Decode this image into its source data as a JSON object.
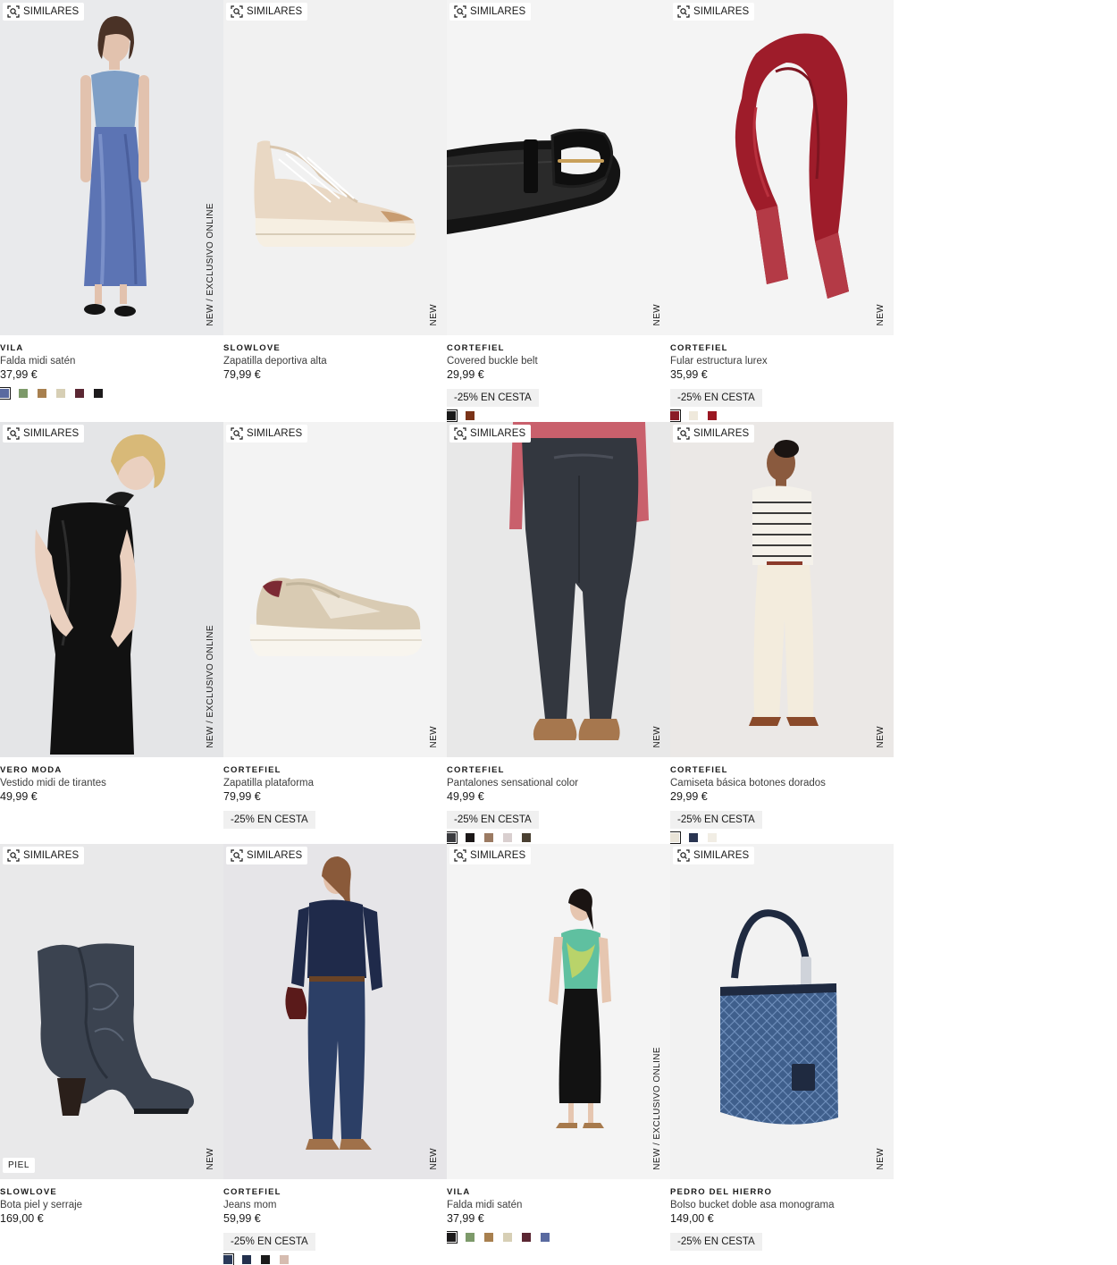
{
  "labels": {
    "similares": "SIMILARES"
  },
  "products": [
    {
      "brand": "VILA",
      "name": "Falda midi satén",
      "price": "37,99 €",
      "tag": "NEW  /  EXCLUSIVO ONLINE",
      "promo": null,
      "bg": "#e9eaec",
      "colors": [
        "#5a6aa0",
        "#7d9a6a",
        "#a8804f",
        "#d7cfb5",
        "#5b2733",
        "#1d1b1c"
      ]
    },
    {
      "brand": "SLOWLOVE",
      "name": "Zapatilla deportiva alta",
      "price": "79,99 €",
      "tag": "NEW",
      "promo": null,
      "bg": "#f1f1f1",
      "colors": []
    },
    {
      "brand": "CORTEFIEL",
      "name": "Covered buckle belt",
      "price": "29,99 €",
      "tag": "NEW",
      "promo": "-25% EN CESTA",
      "bg": "#f4f4f4",
      "colors": [
        "#1a1a1a",
        "#7a3318"
      ]
    },
    {
      "brand": "CORTEFIEL",
      "name": "Fular estructura lurex",
      "price": "35,99 €",
      "tag": "NEW",
      "promo": "-25% EN CESTA",
      "bg": "#f4f4f4",
      "colors": [
        "#8a1c26",
        "#efe9dc",
        "#9a1722"
      ]
    },
    {
      "brand": "VERO MODA",
      "name": "Vestido midi de tirantes",
      "price": "49,99 €",
      "tag": "NEW  /  EXCLUSIVO ONLINE",
      "promo": null,
      "bg": "#e4e5e7",
      "colors": []
    },
    {
      "brand": "CORTEFIEL",
      "name": "Zapatilla plataforma",
      "price": "79,99 €",
      "tag": "NEW",
      "promo": "-25% EN CESTA",
      "bg": "#f3f3f3",
      "colors": []
    },
    {
      "brand": "CORTEFIEL",
      "name": "Pantalones sensational color",
      "price": "49,99 €",
      "tag": "NEW",
      "promo": "-25% EN CESTA",
      "bg": "#e8e8e8",
      "colors": [
        "#3a3b3f",
        "#1b1717",
        "#9b7a62",
        "#d9cfcf",
        "#4a4032"
      ]
    },
    {
      "brand": "CORTEFIEL",
      "name": "Camiseta básica botones dorados",
      "price": "29,99 €",
      "tag": "NEW",
      "promo": "-25% EN CESTA",
      "bg": "#ebe8e6",
      "colors": [
        "#e9e4d8",
        "#2a3552",
        "#f1ede4"
      ]
    },
    {
      "brand": "SLOWLOVE",
      "name": "Bota piel y serraje",
      "price": "169,00 €",
      "tag": "NEW",
      "promo": null,
      "badge": "PIEL",
      "bg": "#e9e9ea",
      "colors": []
    },
    {
      "brand": "CORTEFIEL",
      "name": "Jeans mom",
      "price": "59,99 €",
      "tag": "NEW",
      "promo": "-25% EN CESTA",
      "bg": "#e6e5e8",
      "colors": [
        "#2b3a5a",
        "#23304d",
        "#1a1a1a",
        "#d6bcb0"
      ]
    },
    {
      "brand": "VILA",
      "name": "Falda midi satén",
      "price": "37,99 €",
      "tag": "NEW  /  EXCLUSIVO ONLINE",
      "promo": null,
      "bg": "#f4f4f4",
      "colors": [
        "#1d1b1c",
        "#7d9a6a",
        "#a8804f",
        "#d7cfb5",
        "#5b2733",
        "#5a6aa0"
      ]
    },
    {
      "brand": "PEDRO DEL HIERRO",
      "name": "Bolso bucket doble asa monograma",
      "price": "149,00 €",
      "tag": "NEW",
      "promo": "-25% EN CESTA",
      "bg": "#f2f2f2",
      "colors": []
    }
  ]
}
